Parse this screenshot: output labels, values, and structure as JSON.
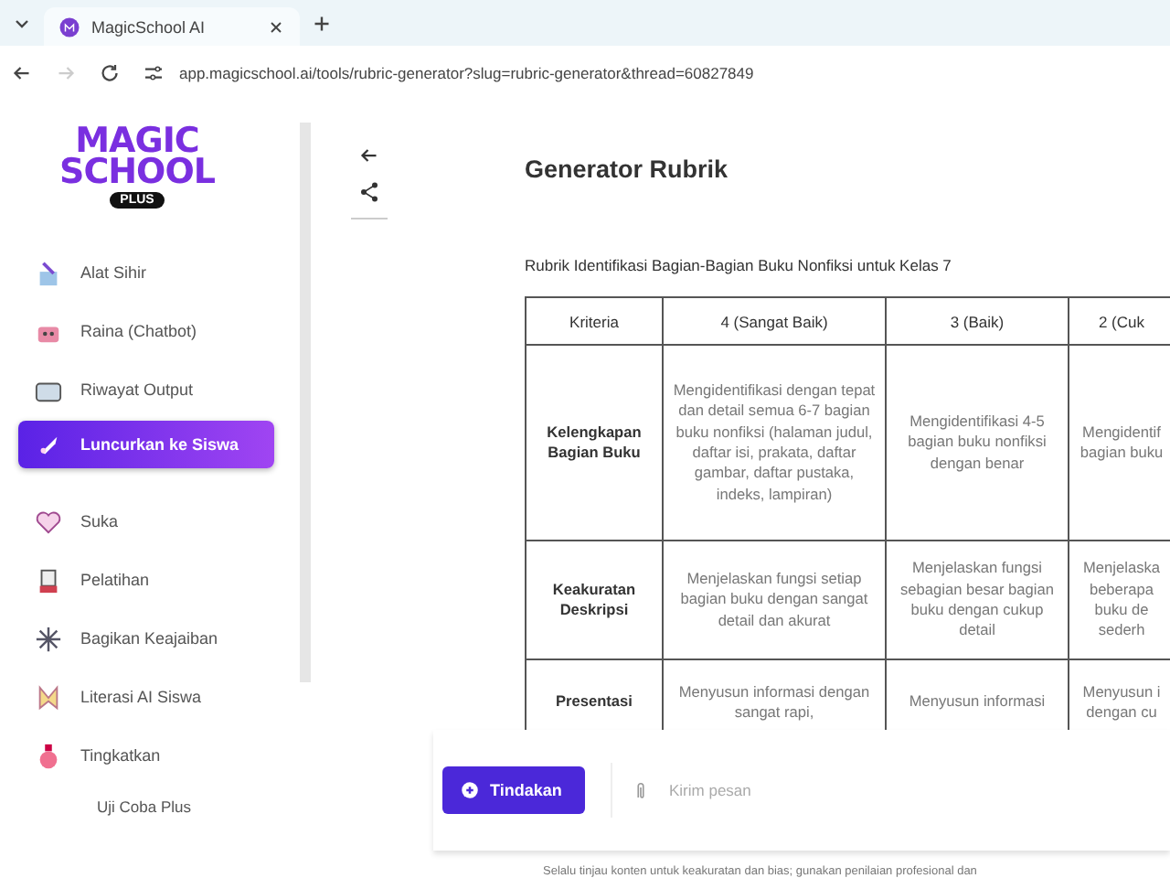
{
  "browser": {
    "tab_title": "MagicSchool AI",
    "url": "app.magicschool.ai/tools/rubric-generator?slug=rubric-generator&thread=60827849",
    "forward_disabled": true
  },
  "logo": {
    "line_1": "MAGIC",
    "line_2": "SCHOOL",
    "badge": "PLUS"
  },
  "sidebar": {
    "items": [
      {
        "label": "Alat Sihir",
        "selected": false
      },
      {
        "label": "Raina (Chatbot)",
        "selected": false
      },
      {
        "label": "Riwayat Output",
        "selected": false
      },
      {
        "label": "Luncurkan ke Siswa",
        "selected": true
      },
      {
        "label": "Suka",
        "selected": false
      },
      {
        "label": "Pelatihan",
        "selected": false
      },
      {
        "label": "Bagikan Keajaiban",
        "selected": false
      },
      {
        "label": "Literasi AI Siswa",
        "selected": false
      },
      {
        "label": "Tingkatkan",
        "selected": false
      }
    ],
    "trial_link": "Uji Coba Plus"
  },
  "page": {
    "title": "Generator Rubrik",
    "subtitle": "Rubrik Identifikasi Bagian-Bagian Buku Nonfiksi untuk Kelas 7"
  },
  "table": {
    "columns": [
      "Kriteria",
      "4 (Sangat Baik)",
      "3 (Baik)",
      "2 (Cuk"
    ],
    "rows": [
      [
        "Kelengkapan Bagian Buku",
        "Mengidentifikasi dengan tepat dan detail semua 6-7 bagian buku nonfiksi (halaman judul, daftar isi, prakata, daftar gambar, daftar pustaka, indeks, lampiran)",
        "Mengidentifikasi 4-5 bagian buku nonfiksi dengan benar",
        "Mengidentif bagian buku"
      ],
      [
        "Keakuratan Deskripsi",
        "Menjelaskan fungsi setiap bagian buku dengan sangat detail dan akurat",
        "Menjelaskan fungsi sebagian besar bagian buku dengan cukup detail",
        "Menjelaska beberapa buku de sederh"
      ],
      [
        "Presentasi",
        "Menyusun informasi dengan sangat rapi,",
        "Menyusun informasi",
        "Menyusun i dengan cu"
      ]
    ]
  },
  "composer": {
    "action_button": "Tindakan",
    "placeholder": "Kirim pesan"
  },
  "footer": "Selalu tinjau konten untuk keakuratan dan bias; gunakan penilaian profesional dan"
}
